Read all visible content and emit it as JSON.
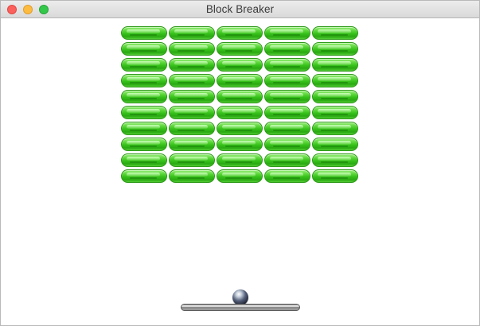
{
  "window": {
    "title": "Block Breaker",
    "buttons": [
      "close",
      "minimize",
      "zoom"
    ]
  },
  "game": {
    "bricks": {
      "rows": 10,
      "columns": 5,
      "color": "#37c11b"
    },
    "ball": {
      "icon": "ball-icon"
    },
    "paddle": {
      "icon": "paddle-icon"
    }
  }
}
